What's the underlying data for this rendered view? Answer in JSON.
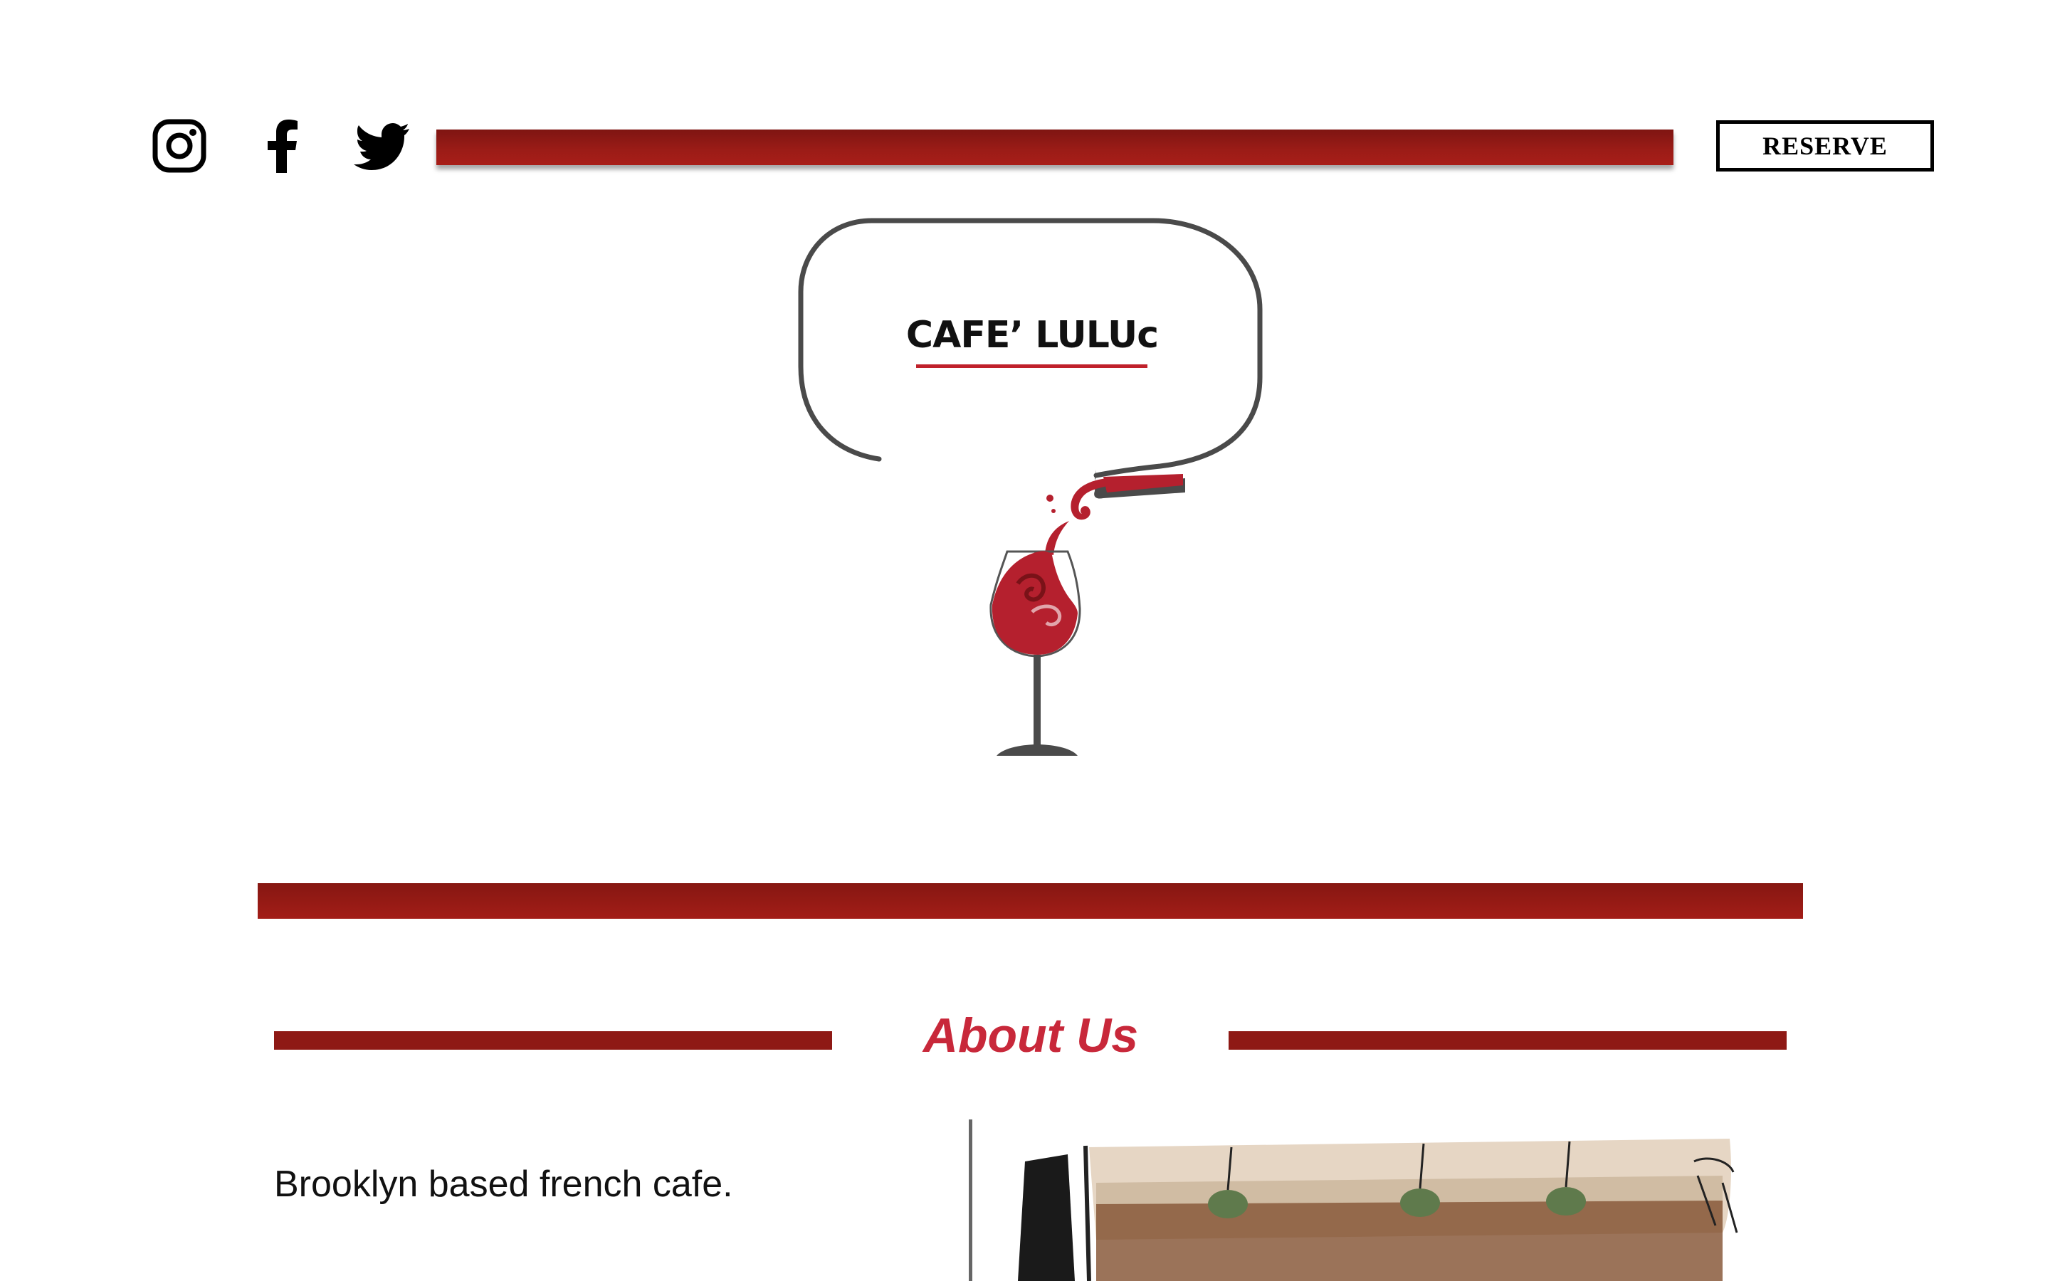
{
  "header": {
    "social": [
      {
        "name": "instagram-icon"
      },
      {
        "name": "facebook-icon"
      },
      {
        "name": "twitter-icon"
      }
    ],
    "reserve_label": "RESERVE"
  },
  "logo": {
    "text": "CAFE’ LULUc"
  },
  "about": {
    "title": "About Us",
    "body": "Brooklyn based french cafe."
  },
  "colors": {
    "brand_red": "#9c1c17",
    "title_red": "#c8283a",
    "wine_red": "#b5202e"
  }
}
